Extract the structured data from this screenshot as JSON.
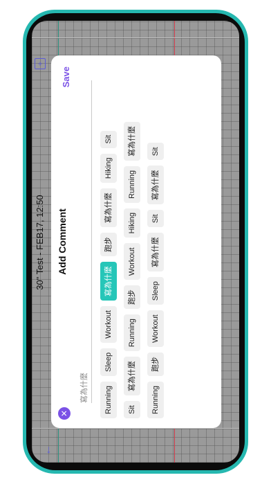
{
  "app": {
    "title": "30\" Test - FEB17, 12:50"
  },
  "icons": {
    "back": "back-arrow-icon",
    "add": "add-note-icon",
    "delete": "trash-icon",
    "close": "close-icon"
  },
  "dialog": {
    "title": "Add Comment",
    "save_label": "Save",
    "close_symbol": "✕",
    "input_placeholder": "寫為什麼",
    "input_value": "",
    "rows": [
      [
        "Running",
        "Sleep",
        "Workout",
        "寫為什麼",
        "跑步",
        "寫為什麼",
        "Hiking",
        "Sit"
      ],
      [
        "Sit",
        "寫為什麼",
        "Running",
        "跑步",
        "Workout",
        "Hiking",
        "Running",
        "寫為什麼"
      ],
      [
        "Running",
        "跑步",
        "Workout",
        "Sleep",
        "寫為什麼",
        "Sit",
        "寫為什麼",
        "Sit"
      ]
    ],
    "selected_chip": "寫為什麼"
  },
  "colors": {
    "accent": "#7b52e6",
    "teal": "#26c6b8",
    "frame": "#26b8b0"
  }
}
